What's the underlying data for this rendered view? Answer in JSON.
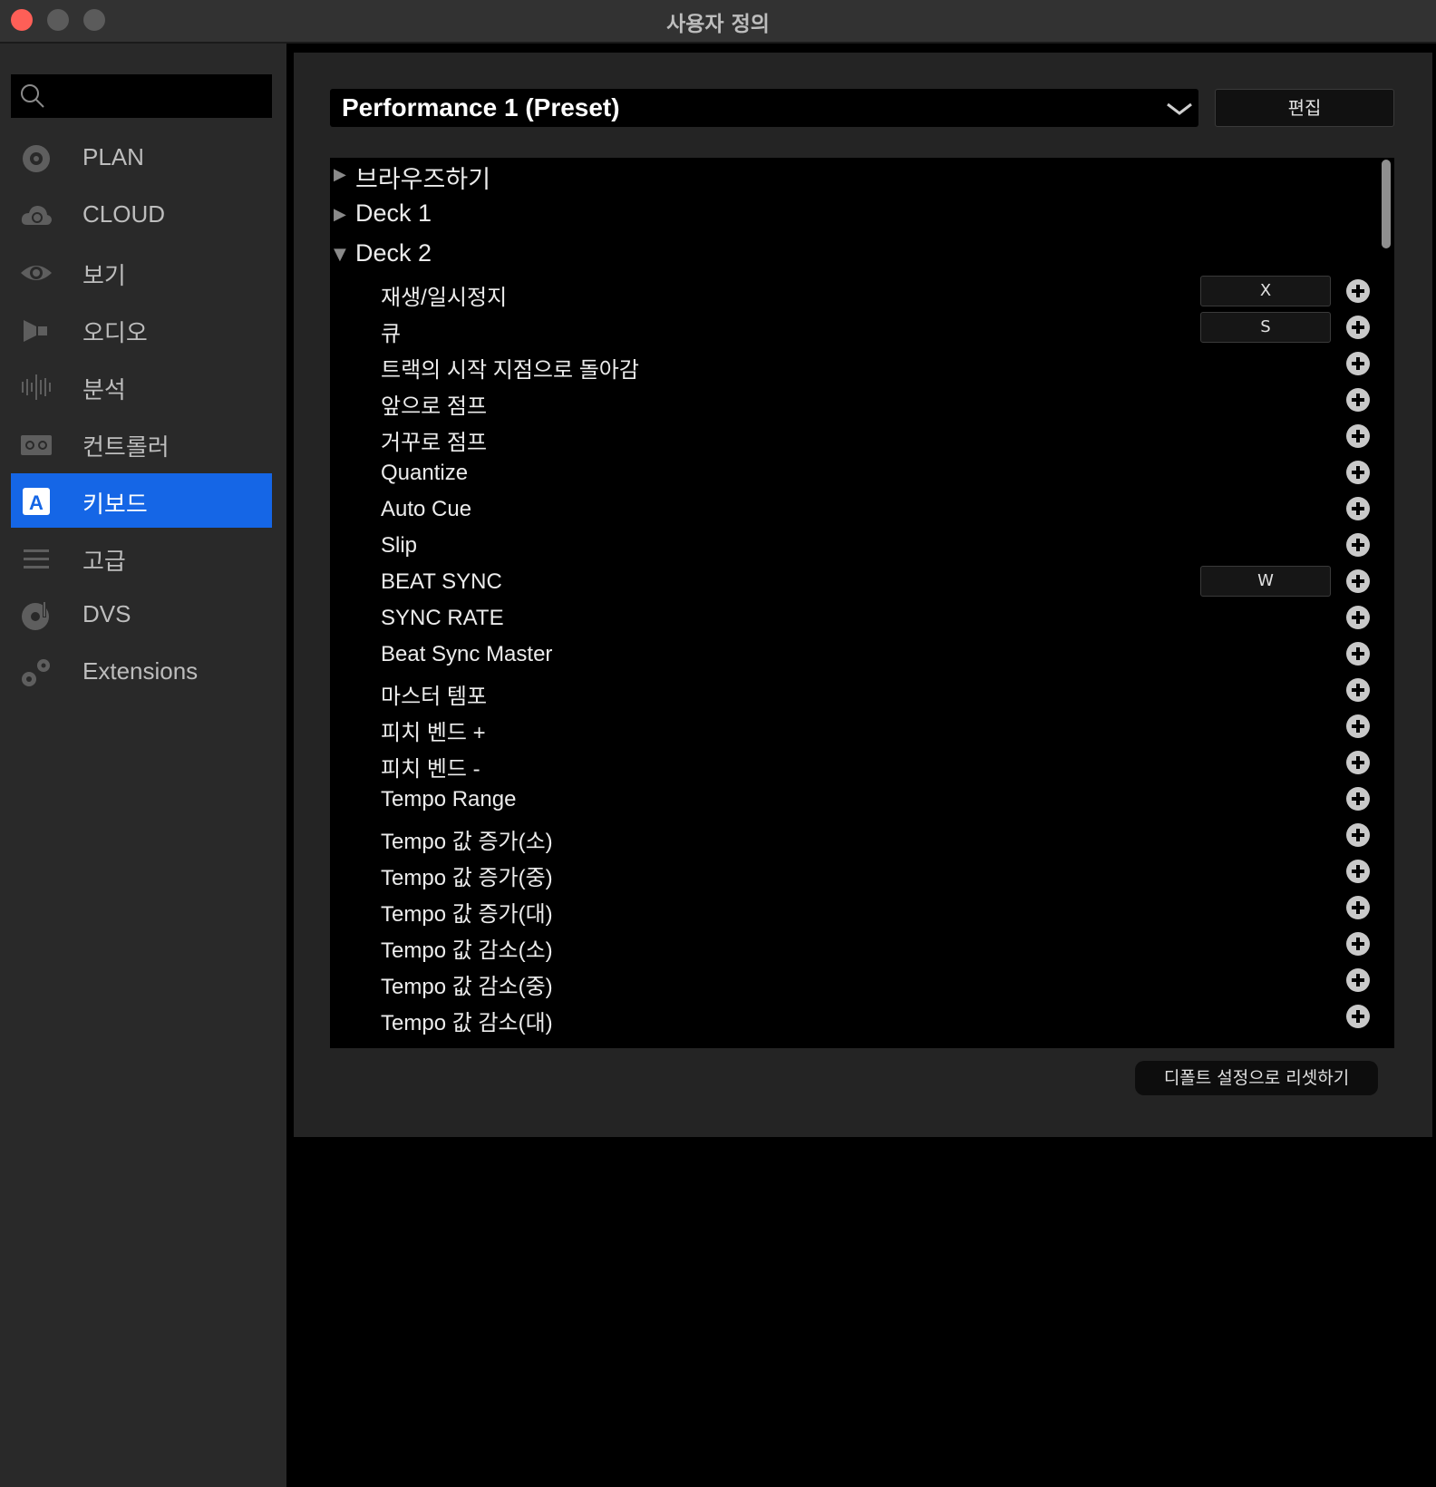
{
  "window": {
    "title": "사용자 정의"
  },
  "sidebar": {
    "search": {
      "placeholder": ""
    },
    "items": [
      {
        "label": "PLAN",
        "icon": "plan-icon"
      },
      {
        "label": "CLOUD",
        "icon": "cloud-icon"
      },
      {
        "label": "보기",
        "icon": "eye-icon"
      },
      {
        "label": "오디오",
        "icon": "speaker-icon"
      },
      {
        "label": "분석",
        "icon": "waveform-icon"
      },
      {
        "label": "컨트롤러",
        "icon": "controller-icon"
      },
      {
        "label": "키보드",
        "icon": "keyboard-icon",
        "active": true
      },
      {
        "label": "고급",
        "icon": "menu-icon"
      },
      {
        "label": "DVS",
        "icon": "dvs-icon"
      },
      {
        "label": "Extensions",
        "icon": "gears-icon"
      }
    ]
  },
  "main": {
    "preset": {
      "label": "Performance 1 (Preset)",
      "icon": "chevron-down-icon"
    },
    "edit_label": "편집",
    "groups": [
      {
        "label": "브라우즈하기",
        "expanded": false
      },
      {
        "label": "Deck 1",
        "expanded": false
      },
      {
        "label": "Deck 2",
        "expanded": true
      }
    ],
    "items": [
      {
        "label": "재생/일시정지",
        "key": "X"
      },
      {
        "label": "큐",
        "key": "S"
      },
      {
        "label": "트랙의 시작 지점으로 돌아감",
        "key": ""
      },
      {
        "label": "앞으로 점프",
        "key": ""
      },
      {
        "label": "거꾸로 점프",
        "key": ""
      },
      {
        "label": "Quantize",
        "key": ""
      },
      {
        "label": "Auto Cue",
        "key": ""
      },
      {
        "label": "Slip",
        "key": ""
      },
      {
        "label": "BEAT SYNC",
        "key": "W"
      },
      {
        "label": "SYNC RATE",
        "key": ""
      },
      {
        "label": "Beat Sync Master",
        "key": ""
      },
      {
        "label": "마스터 템포",
        "key": ""
      },
      {
        "label": "피치 벤드 +",
        "key": ""
      },
      {
        "label": "피치 벤드 -",
        "key": ""
      },
      {
        "label": "Tempo Range",
        "key": ""
      },
      {
        "label": "Tempo 값 증가(소)",
        "key": ""
      },
      {
        "label": "Tempo 값 증가(중)",
        "key": ""
      },
      {
        "label": "Tempo 값 증가(대)",
        "key": ""
      },
      {
        "label": "Tempo 값 감소(소)",
        "key": ""
      },
      {
        "label": "Tempo 값 감소(중)",
        "key": ""
      },
      {
        "label": "Tempo 값 감소(대)",
        "key": ""
      }
    ],
    "reset_label": "디폴트 설정으로 리셋하기"
  },
  "colors": {
    "accent": "#1566e6",
    "close": "#fe5f57"
  }
}
